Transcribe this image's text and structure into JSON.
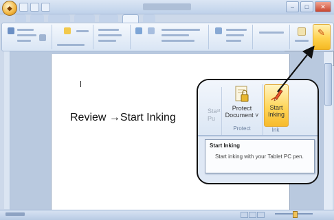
{
  "caption": {
    "text": "Review →Start Inking"
  },
  "callout": {
    "partial_label": "Staˢᵗ\nPu",
    "protect_button": {
      "label": "Protect\nDocument ˅"
    },
    "protect_group": "Protect",
    "start_inking_button": {
      "label": "Start\nInking"
    },
    "ink_group": "Ink",
    "tooltip": {
      "title": "Start Inking",
      "body": "Start inking with your Tablet PC pen."
    }
  },
  "icons": {
    "office_button": "office-logo-icon",
    "pen": "pen-icon",
    "protect": "protect-document-icon"
  },
  "colors": {
    "ribbon": "#dbe6f4",
    "highlight": "#ffd24d",
    "callout_border": "#111111"
  }
}
